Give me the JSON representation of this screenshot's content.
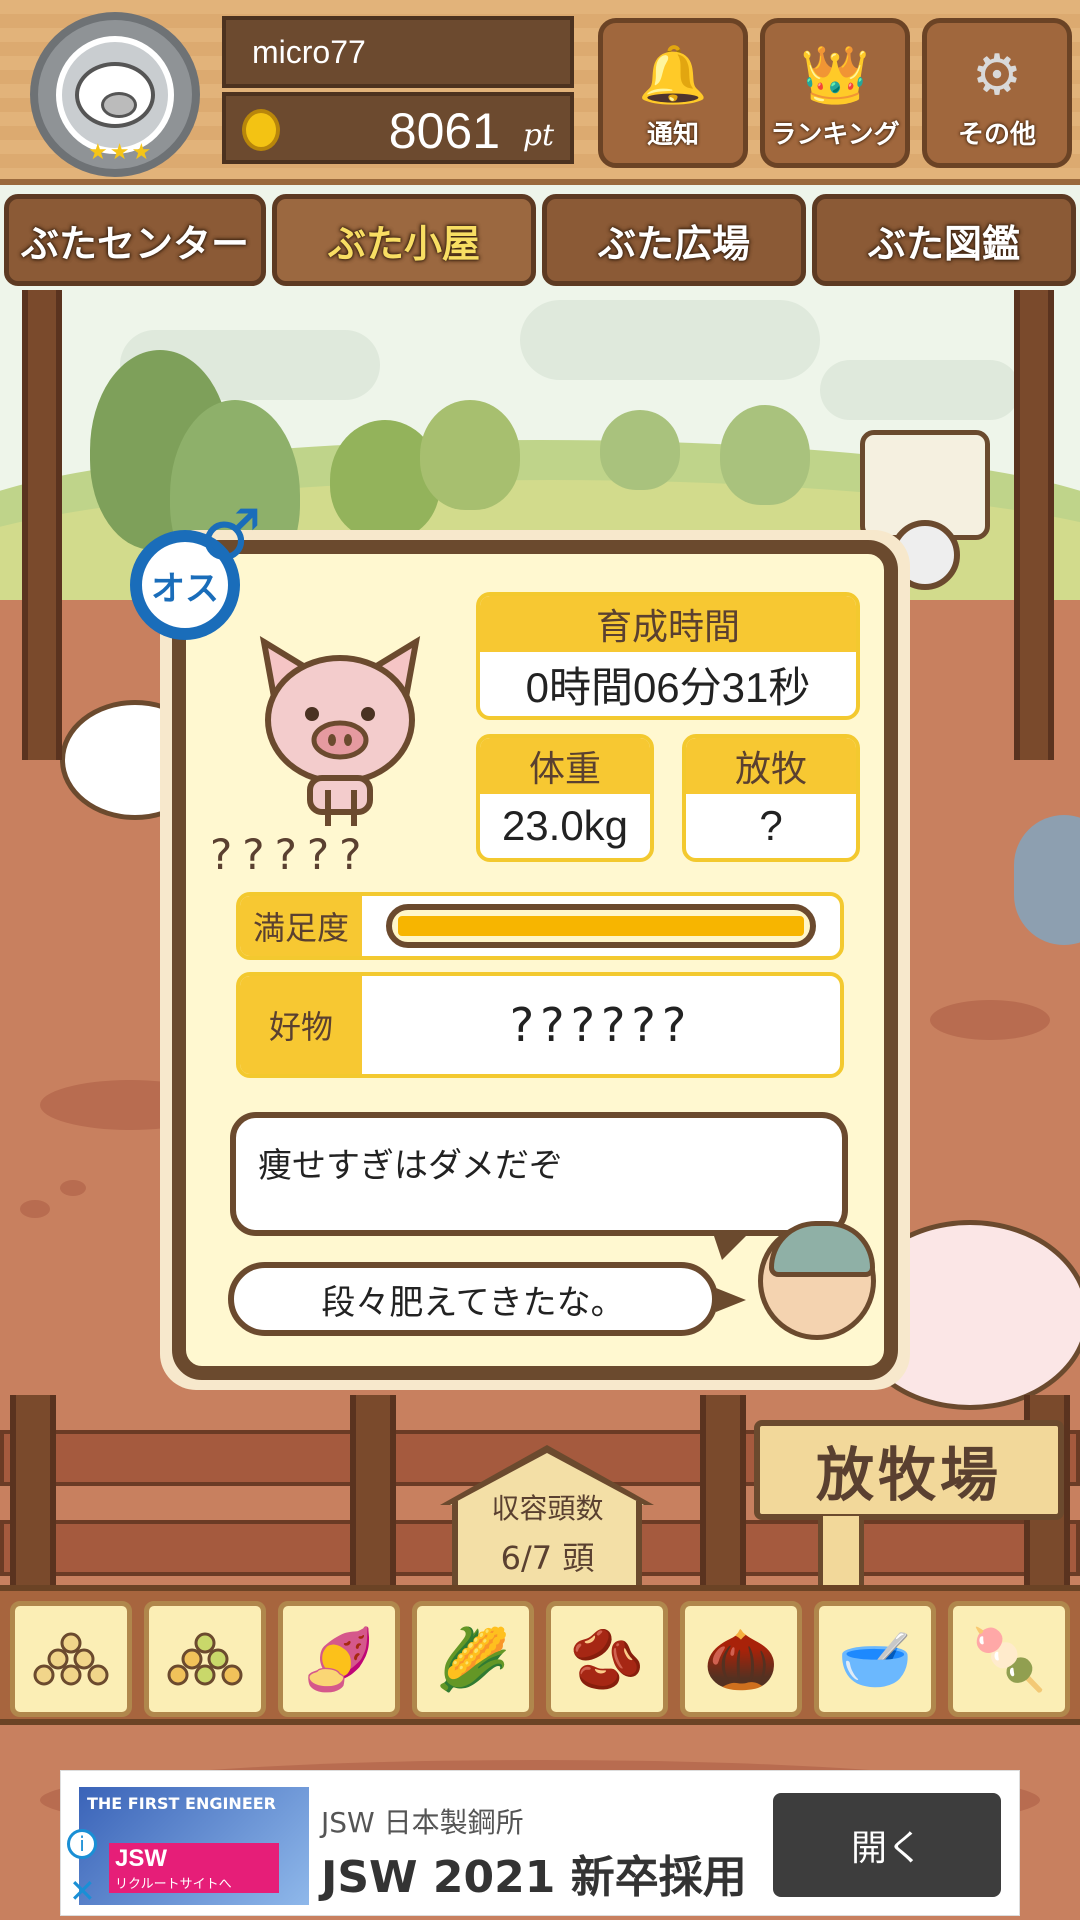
{
  "header": {
    "username": "micro77",
    "points": "8061",
    "points_unit": "pt",
    "stars": "★★★",
    "buttons": [
      {
        "label": "通知",
        "icon": "bell-icon",
        "glyph": "🔔"
      },
      {
        "label": "ランキング",
        "icon": "crown-icon",
        "glyph": "👑"
      },
      {
        "label": "その他",
        "icon": "gear-icon",
        "glyph": "⚙"
      }
    ]
  },
  "tabs": [
    {
      "label": "ぶたセンター",
      "active": false
    },
    {
      "label": "ぶた小屋",
      "active": true
    },
    {
      "label": "ぶた広場",
      "active": false
    },
    {
      "label": "ぶた図鑑",
      "active": false
    }
  ],
  "pig": {
    "gender_label": "オス",
    "gender_symbol": "♂",
    "name": "?????",
    "growth_time_label": "育成時間",
    "growth_time_value": "0時間06分31秒",
    "weight_label": "体重",
    "weight_value": "23.0kg",
    "pasture_label": "放牧",
    "pasture_value": "?",
    "satisfaction_label": "満足度",
    "satisfaction_level": 1.0,
    "favorite_label": "好物",
    "favorite_value": "??????",
    "speech_top": "痩せすぎはダメだぞ",
    "speech_bottom": "段々肥えてきたな。"
  },
  "capacity": {
    "label": "収容頭数",
    "value": "6/7 頭"
  },
  "pasture_sign": "放牧場",
  "foods": [
    {
      "icon": "grain-pile-icon",
      "glyph": "⚬"
    },
    {
      "icon": "mixed-grain-icon",
      "glyph": "⚬"
    },
    {
      "icon": "sweet-potato-icon",
      "glyph": "🍠"
    },
    {
      "icon": "corn-icon",
      "glyph": "🌽"
    },
    {
      "icon": "soybean-icon",
      "glyph": "🫘"
    },
    {
      "icon": "acorn-icon",
      "glyph": "🌰"
    },
    {
      "icon": "grain-bowl-icon",
      "glyph": "🥣"
    },
    {
      "icon": "meatball-plate-icon",
      "glyph": "🍡"
    }
  ],
  "ad": {
    "image_text": "THE FIRST ENGINEER",
    "brand_text": "JSW",
    "brand_sub": "日本製鋼所",
    "brand_link": "リクルートサイトへ",
    "advertiser": "JSW 日本製鋼所",
    "title": "JSW 2021 新卒採用",
    "cta": "開く",
    "info_glyph": "i",
    "close_glyph": "✕"
  },
  "colors": {
    "wood": "#8b5a36",
    "panel": "#fff8d0",
    "accent_yellow": "#f7c832",
    "male_blue": "#1a6dba",
    "ad_pink": "#e61e78"
  }
}
